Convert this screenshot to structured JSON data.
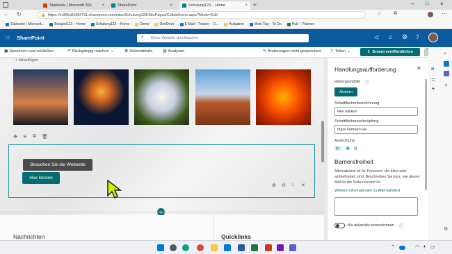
{
  "browser": {
    "tabs": [
      {
        "label": "Startseite | Microsoft 365",
        "color": "#d83b01"
      },
      {
        "label": "SharePoint",
        "color": "#038387"
      },
      {
        "label": "Schulung123 – Home",
        "color": "#038387"
      }
    ],
    "url": "https://m365x81384711.sharepoint.com/sites/Schulung123/SitePages/CollabHome.aspx?Mode=Edit",
    "bookmarks": [
      {
        "label": "Startseite | Microsof...",
        "color": "#0078d4"
      },
      {
        "label": "Beispiel123 – Home",
        "color": "#038387"
      },
      {
        "label": "Schulung123 – Home",
        "color": "#038387"
      },
      {
        "label": "Demo",
        "color": "#f2c94c"
      },
      {
        "label": "OneDrive",
        "color": "#f2c94c"
      },
      {
        "label": "E-Mail – Trainer – O...",
        "color": "#0078d4"
      },
      {
        "label": "Aufgaben",
        "color": "#f2c94c"
      },
      {
        "label": "Mein Tag – To Do",
        "color": "#2564cf"
      },
      {
        "label": "Hub – Planner",
        "color": "#31752f"
      }
    ]
  },
  "suite": {
    "app_name": "SharePoint",
    "search_placeholder": "Diese Website durchsuchen"
  },
  "commandbar": {
    "save_close": "Speichern und schließen",
    "undo": "Rückgängig machen",
    "page_details": "Seitendetails",
    "analytics": "Analysen",
    "unsaved": "Änderungen nicht gespeichert",
    "share": "Teilen",
    "republish": "Erneut veröffentlichen"
  },
  "canvas": {
    "add_link": "+ Hinzufügen",
    "visit_button": "Besuchen Sie die Webseite",
    "click_button": "Hier klicken",
    "news_title": "Nachrichten",
    "quicklinks_title": "Quicklinks"
  },
  "pane": {
    "title": "Handlungsaufforderung",
    "bg_image_label": "Hintergrundbild",
    "change_button": "Ändern",
    "button_label_label": "Schaltflächenbezeichnung",
    "button_label_value": "Hier klicken",
    "button_link_label": "Schaltflächenverknüpfung",
    "button_link_value": "https://artreich.de",
    "alignment_label": "Ausrichtung",
    "accessibility_title": "Barrierefreiheit",
    "accessibility_text": "Alternativtext ist für Personen, die blind oder sehbehindert sind. Beschreiben Sie kurz, wie dieses Bild für die Seite relevant ist.",
    "alt_text_link": "Weitere Informationen zu Alternativtext",
    "decorative_label": "Als dekorativ kennzeichnen"
  }
}
